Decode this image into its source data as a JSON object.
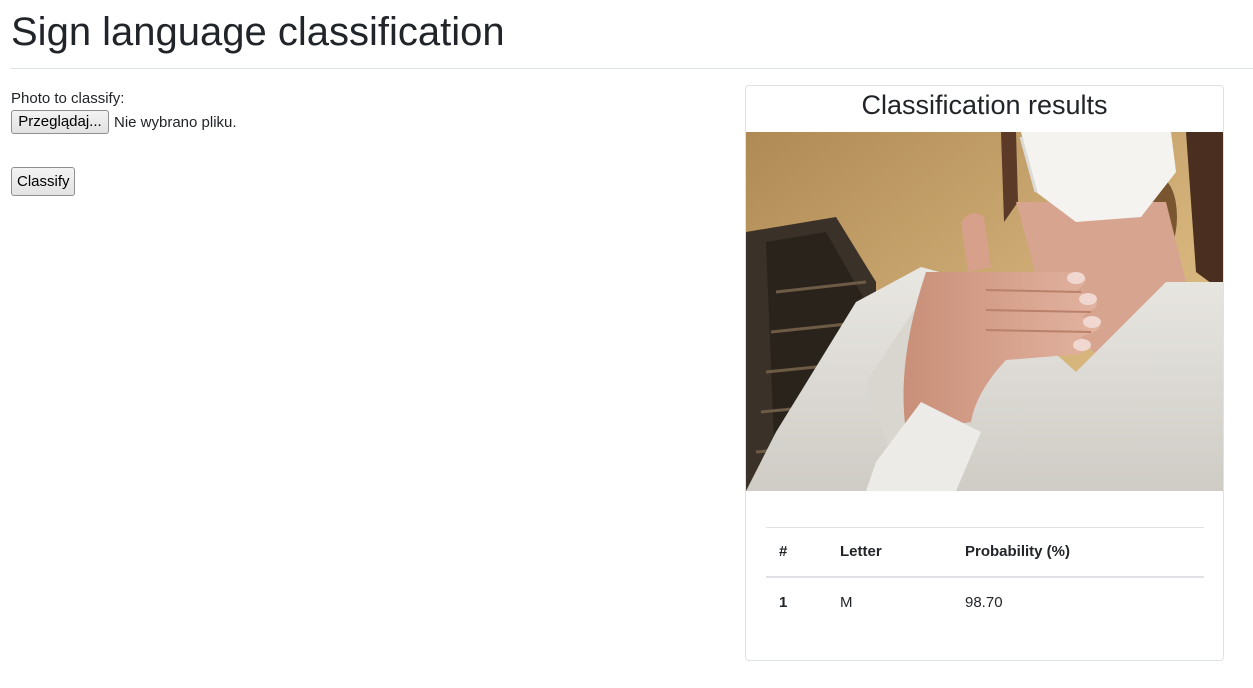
{
  "page": {
    "title": "Sign language classification"
  },
  "form": {
    "photo_label": "Photo to classify:",
    "browse_button": "Przeglądaj...",
    "file_status": "Nie wybrano pliku.",
    "classify_button": "Classify"
  },
  "results": {
    "title": "Classification results",
    "image_subject": "person wearing a white face mask and knit sweater showing a hand sign",
    "table": {
      "headers": [
        "#",
        "Letter",
        "Probability (%)"
      ],
      "rows": [
        {
          "rank": "1",
          "letter": "M",
          "probability": "98.70"
        }
      ]
    }
  },
  "colors": {
    "text": "#212529",
    "border": "#dee2e6",
    "button_bg": "#e9e9e9"
  }
}
